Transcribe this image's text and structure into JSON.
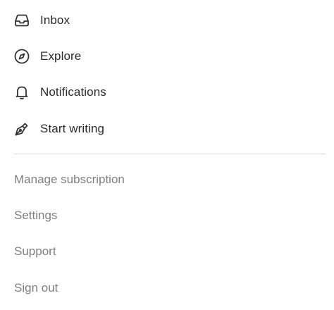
{
  "primary_nav": [
    {
      "label": "Inbox",
      "icon": "inbox-icon"
    },
    {
      "label": "Explore",
      "icon": "compass-icon"
    },
    {
      "label": "Notifications",
      "icon": "bell-icon"
    },
    {
      "label": "Start writing",
      "icon": "pen-nib-icon"
    }
  ],
  "secondary_nav": [
    {
      "label": "Manage subscription"
    },
    {
      "label": "Settings"
    },
    {
      "label": "Support"
    },
    {
      "label": "Sign out"
    }
  ],
  "colors": {
    "primary_text": "#2a2a2a",
    "secondary_text": "#808080",
    "divider": "#d9d9d9",
    "background": "#ffffff"
  }
}
